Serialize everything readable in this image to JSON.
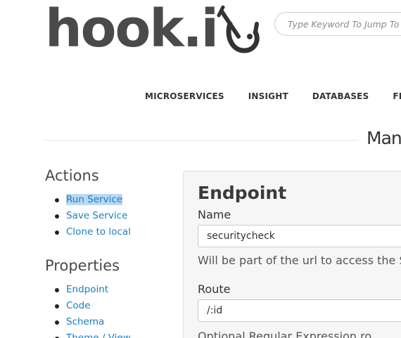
{
  "logo": {
    "text": "hook.i"
  },
  "search": {
    "placeholder": "Type Keyword To Jump To"
  },
  "nav": {
    "items": [
      "MICROSERVICES",
      "INSIGHT",
      "DATABASES",
      "FILE STO"
    ]
  },
  "page_title": "Man",
  "sidebar": {
    "actions": {
      "heading": "Actions",
      "items": [
        "Run Service",
        "Save Service",
        "Clone to local"
      ]
    },
    "properties": {
      "heading": "Properties",
      "items": [
        "Endpoint",
        "Code",
        "Schema",
        "Theme / View"
      ]
    }
  },
  "panel": {
    "title": "Endpoint",
    "name_label": "Name",
    "name_value": "securitycheck",
    "name_help": "Will be part of the url to access the S",
    "route_label": "Route",
    "route_value": "/:id",
    "route_help": "Optional Regular Expression ro"
  },
  "colors": {
    "link": "#1a7fbf",
    "selection": "#b9d8f3",
    "logo": "#4a4a4a"
  }
}
